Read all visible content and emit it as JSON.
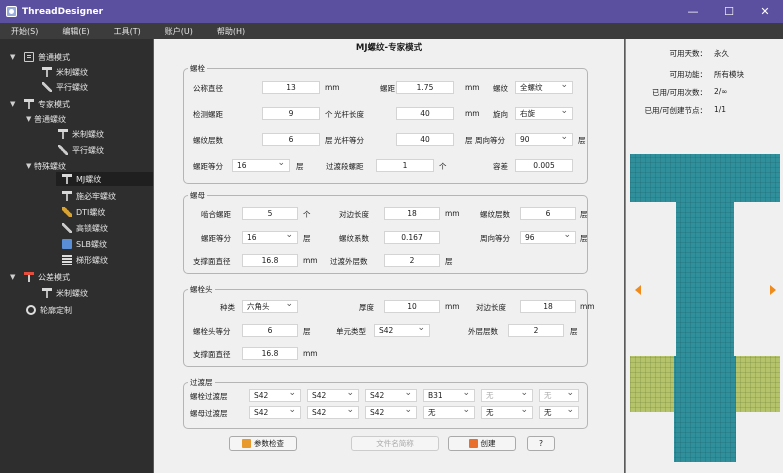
{
  "app": {
    "title": "ThreadDesigner"
  },
  "window_controls": {
    "minimize": "—",
    "maximize": "☐",
    "close": "✕"
  },
  "menu": [
    "开始(S)",
    "编辑(E)",
    "工具(T)",
    "账户(U)",
    "帮助(H)"
  ],
  "sidebar": [
    {
      "label": "普通模式",
      "icon": "doc"
    },
    {
      "label": "米制螺纹",
      "icon": "bolt"
    },
    {
      "label": "平行螺纹",
      "icon": "wrench"
    },
    {
      "label": "专家模式",
      "icon": "bolt"
    },
    {
      "label": "普通螺纹",
      "icon": "bolt"
    },
    {
      "label": "米制螺纹",
      "icon": "bolt"
    },
    {
      "label": "平行螺纹",
      "icon": "wrench"
    },
    {
      "label": "特殊螺纹",
      "icon": "wrench"
    },
    {
      "label": "MJ螺纹",
      "icon": "bolt",
      "selected": true
    },
    {
      "label": "施必牢螺纹",
      "icon": "bolt"
    },
    {
      "label": "DTI螺纹",
      "icon": "gold"
    },
    {
      "label": "高锁螺纹",
      "icon": "wrench"
    },
    {
      "label": "SLB螺纹",
      "icon": "blue"
    },
    {
      "label": "梯形螺纹",
      "icon": "stack"
    },
    {
      "label": "公差模式",
      "icon": "red"
    },
    {
      "label": "米制螺纹",
      "icon": "bolt"
    },
    {
      "label": "轮廓定制",
      "icon": "gear"
    }
  ],
  "main": {
    "title": "MJ螺纹-专家模式",
    "bolt": {
      "title": "螺栓",
      "nominal_dia": {
        "label": "公称直径",
        "value": "13",
        "unit": "mm"
      },
      "pitch": {
        "label": "螺距",
        "value": "1.75",
        "unit": "mm"
      },
      "thread_type": {
        "label": "螺纹",
        "value": "全螺纹"
      },
      "thread_len": {
        "label": "检测螺距",
        "value": "9",
        "unit": "个"
      },
      "shank_len": {
        "label": "光杆长度",
        "value": "40",
        "unit": "mm"
      },
      "direction": {
        "label": "旋向",
        "value": "右旋"
      },
      "layers": {
        "label": "螺纹层数",
        "value": "6",
        "unit": "层"
      },
      "shank_div": {
        "label": "光杆等分",
        "value": "40",
        "unit": "层"
      },
      "circ_div": {
        "label": "周向等分",
        "value": "90",
        "unit": "层"
      },
      "pitch_div": {
        "label": "螺距等分",
        "value": "16",
        "unit": "层"
      },
      "transition": {
        "label": "过渡段螺距",
        "value": "1",
        "unit": "个"
      },
      "tolerance": {
        "label": "容差",
        "value": "0.005"
      }
    },
    "nut": {
      "title": "螺母",
      "engaged": {
        "label": "啮合螺距",
        "value": "5",
        "unit": "个"
      },
      "across_flats": {
        "label": "对边长度",
        "value": "18",
        "unit": "mm"
      },
      "layers": {
        "label": "螺纹层数",
        "value": "6",
        "unit": "层"
      },
      "pitch_div": {
        "label": "螺距等分",
        "value": "16",
        "unit": "层"
      },
      "factor": {
        "label": "螺纹系数",
        "value": "0.167"
      },
      "circ_div": {
        "label": "周向等分",
        "value": "96",
        "unit": "层"
      },
      "bearing_dia": {
        "label": "支撑面直径",
        "value": "16.8",
        "unit": "mm"
      },
      "outer_layers": {
        "label": "过渡外层数",
        "value": "2",
        "unit": "层"
      }
    },
    "head": {
      "title": "螺栓头",
      "type": {
        "label": "种类",
        "value": "六角头"
      },
      "thickness": {
        "label": "厚度",
        "value": "10",
        "unit": "mm"
      },
      "across_flats": {
        "label": "对边长度",
        "value": "18",
        "unit": "mm"
      },
      "div": {
        "label": "螺栓头等分",
        "value": "6",
        "unit": "层"
      },
      "element": {
        "label": "单元类型",
        "value": "S42"
      },
      "outer_layers": {
        "label": "外层层数",
        "value": "2",
        "unit": "层"
      },
      "bearing_dia": {
        "label": "支撑面直径",
        "value": "16.8",
        "unit": "mm"
      }
    },
    "transition": {
      "title": "过渡层",
      "bolt_row": {
        "label": "螺栓过渡层",
        "values": [
          "S42",
          "S42",
          "S42",
          "B31",
          "无",
          "无"
        ]
      },
      "nut_row": {
        "label": "螺母过渡层",
        "values": [
          "S42",
          "S42",
          "S42",
          "无",
          "无",
          "无"
        ]
      }
    },
    "buttons": {
      "check": "参数检查",
      "file": "文件名简称",
      "create": "创建",
      "help": "?"
    }
  },
  "info": [
    {
      "key": "可用天数：",
      "value": "永久"
    },
    {
      "key": "可用功能：",
      "value": "所有模块"
    },
    {
      "key": "已用/可用次数：",
      "value": "2/∞"
    },
    {
      "key": "已用/可创建节点：",
      "value": "1/1"
    }
  ],
  "colors": {
    "title_bar": "#5b4fa0",
    "mesh_blue": "#2f8f9a",
    "mesh_nut": "#b5c46a",
    "arrow": "#f08a1a"
  }
}
